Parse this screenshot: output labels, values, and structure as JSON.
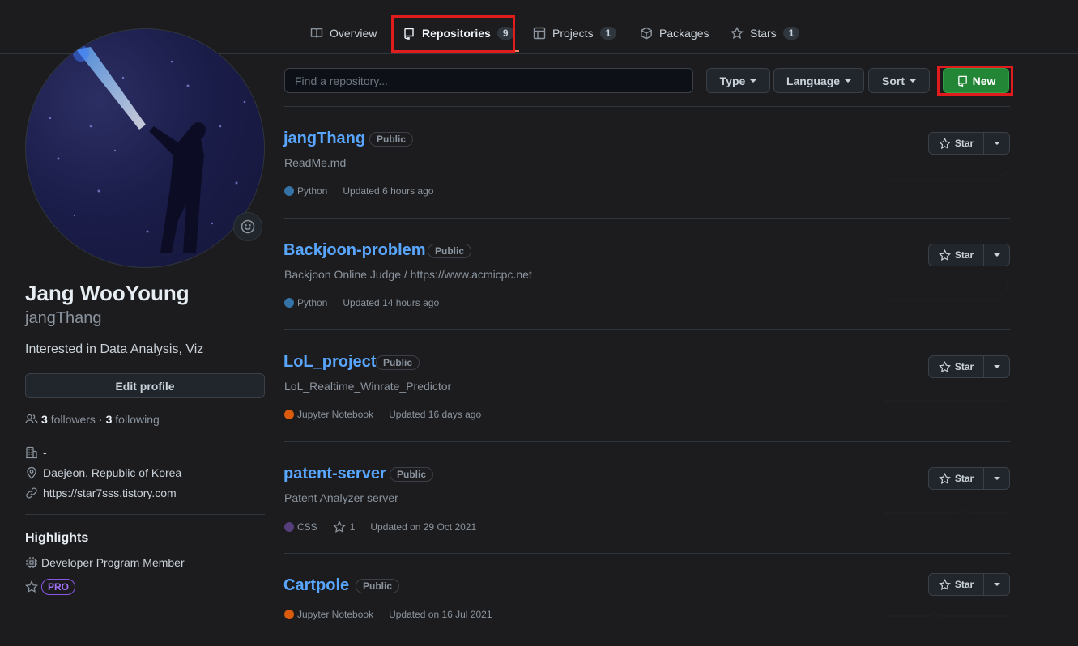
{
  "tabs": [
    {
      "label": "Overview",
      "count": null,
      "icon": "book-icon"
    },
    {
      "label": "Repositories",
      "count": "9",
      "icon": "repo-icon",
      "active": true
    },
    {
      "label": "Projects",
      "count": "1",
      "icon": "table-icon"
    },
    {
      "label": "Packages",
      "count": null,
      "icon": "package-icon"
    },
    {
      "label": "Stars",
      "count": "1",
      "icon": "star-icon"
    }
  ],
  "profile": {
    "fullname": "Jang WooYoung",
    "username": "jangThang",
    "bio": "Interested in Data Analysis, Viz",
    "edit_label": "Edit profile",
    "followers_count": "3",
    "followers_label": "followers",
    "sep": "·",
    "following_count": "3",
    "following_label": "following",
    "company": "-",
    "location": "Daejeon, Republic of Korea",
    "website": "https://star7sss.tistory.com"
  },
  "highlights": {
    "title": "Highlights",
    "member": "Developer Program Member",
    "pro": "PRO"
  },
  "toolbar": {
    "search_placeholder": "Find a repository...",
    "type_label": "Type",
    "language_label": "Language",
    "sort_label": "Sort",
    "new_label": "New"
  },
  "repos": [
    {
      "name": "jangThang",
      "visibility": "Public",
      "description": "ReadMe.md",
      "language": "Python",
      "lang_color": "#3572A5",
      "stars": null,
      "updated": "Updated 6 hours ago",
      "star_label": "Star"
    },
    {
      "name": "Backjoon-problem",
      "visibility": "Public",
      "description": "Backjoon Online Judge / https://www.acmicpc.net",
      "language": "Python",
      "lang_color": "#3572A5",
      "stars": null,
      "updated": "Updated 14 hours ago",
      "star_label": "Star"
    },
    {
      "name": "LoL_project",
      "visibility": "Public",
      "description": "LoL_Realtime_Winrate_Predictor",
      "language": "Jupyter Notebook",
      "lang_color": "#DA5B0B",
      "stars": null,
      "updated": "Updated 16 days ago",
      "star_label": "Star"
    },
    {
      "name": "patent-server",
      "visibility": "Public",
      "description": "Patent Analyzer server",
      "language": "CSS",
      "lang_color": "#563d7c",
      "stars": "1",
      "updated": "Updated on 29 Oct 2021",
      "star_label": "Star"
    },
    {
      "name": "Cartpole",
      "visibility": "Public",
      "description": "",
      "language": "Jupyter Notebook",
      "lang_color": "#DA5B0B",
      "stars": null,
      "updated": "Updated on 16 Jul 2021",
      "star_label": "Star"
    }
  ]
}
